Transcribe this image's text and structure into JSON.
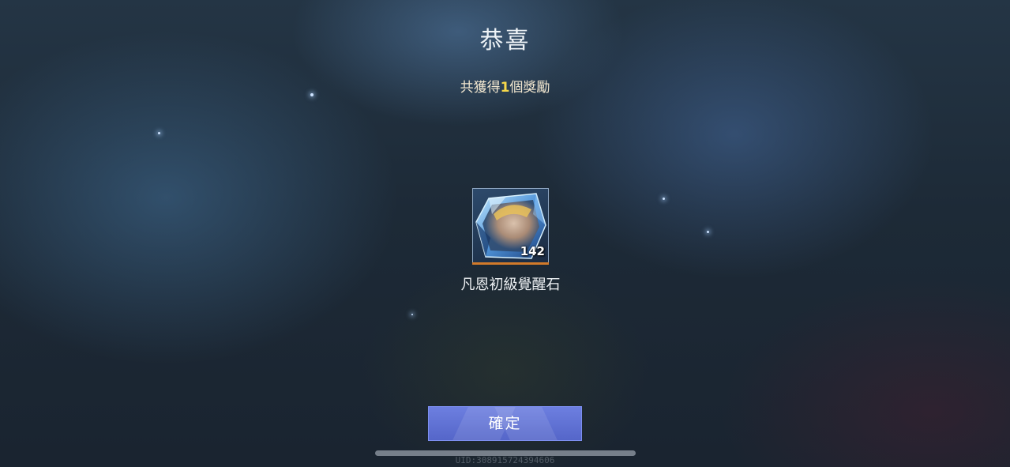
{
  "header": {
    "title": "恭喜",
    "summary_prefix": "共獲得",
    "summary_count": "1",
    "summary_suffix": "個獎勵"
  },
  "reward": {
    "name": "凡恩初級覺醒石",
    "quantity": "142",
    "icon": "awakening-stone-icon"
  },
  "actions": {
    "confirm_label": "確定"
  },
  "footer": {
    "uid": "UID:3089157243946​06"
  },
  "colors": {
    "accent_count": "#f6d84a",
    "button": "#5d6fd3",
    "rarity_underline": "#d27a2a"
  }
}
